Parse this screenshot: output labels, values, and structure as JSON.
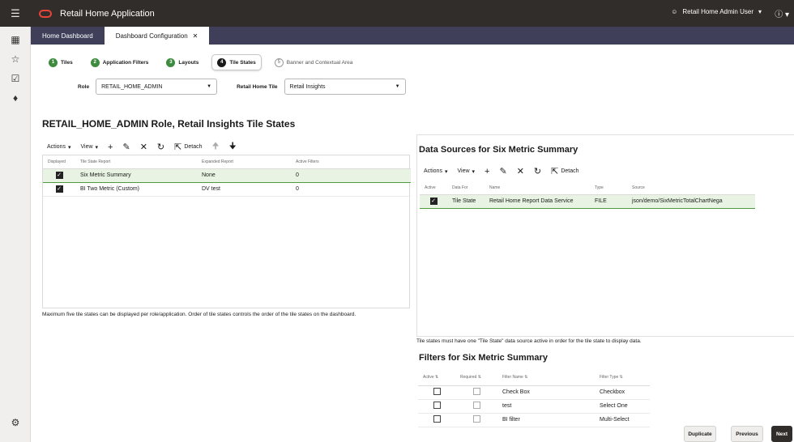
{
  "app": {
    "title": "Retail Home Application",
    "user": "Retail Home Admin User"
  },
  "tabs": [
    {
      "label": "Home Dashboard"
    },
    {
      "label": "Dashboard Configuration"
    }
  ],
  "steps": [
    {
      "num": "1",
      "label": "Tiles"
    },
    {
      "num": "2",
      "label": "Application Filters"
    },
    {
      "num": "3",
      "label": "Layouts"
    },
    {
      "num": "4",
      "label": "Tile States"
    },
    {
      "num": "5",
      "label": "Banner and Contextual Area"
    }
  ],
  "filters": {
    "role_label": "Role",
    "role_value": "RETAIL_HOME_ADMIN",
    "tile_label": "Retail Home Tile",
    "tile_value": "Retail Insights"
  },
  "tile_states": {
    "title": "RETAIL_HOME_ADMIN Role, Retail Insights Tile States",
    "toolbar": {
      "actions": "Actions",
      "view": "View",
      "detach": "Detach"
    },
    "columns": [
      "Displayed",
      "Tile State Report",
      "Expanded Report",
      "Active Filters"
    ],
    "rows": [
      {
        "report": "Six Metric Summary",
        "expanded": "None",
        "filters": "0"
      },
      {
        "report": "BI Two Metric (Custom)",
        "expanded": "DV test",
        "filters": "0"
      }
    ],
    "note": "Maximum five tile states can be displayed per role/application. Order of tile states controls the order of the tile states on the dashboard."
  },
  "data_sources": {
    "title": "Data Sources for Six Metric Summary",
    "toolbar": {
      "actions": "Actions",
      "view": "View",
      "detach": "Detach"
    },
    "columns": [
      "Active",
      "Data For",
      "Name",
      "Type",
      "Source"
    ],
    "rows": [
      {
        "data_for": "Tile State",
        "name": "Retail Home Report Data Service",
        "type": "FILE",
        "source": "json/demo/SixMetricTotalChartNega"
      }
    ],
    "note": "Tile states must have one \"Tile State\" data source active in order for the tile state to display data."
  },
  "filters_panel": {
    "title": "Filters for Six Metric Summary",
    "columns": [
      "Active",
      "Required",
      "Filter Name",
      "Filter Type"
    ],
    "rows": [
      {
        "name": "Check Box",
        "type": "Checkbox"
      },
      {
        "name": "test",
        "type": "Select One"
      },
      {
        "name": "BI filter",
        "type": "Multi-Select"
      }
    ]
  },
  "buttons": {
    "duplicate": "Duplicate",
    "previous": "Previous",
    "next": "Next"
  }
}
